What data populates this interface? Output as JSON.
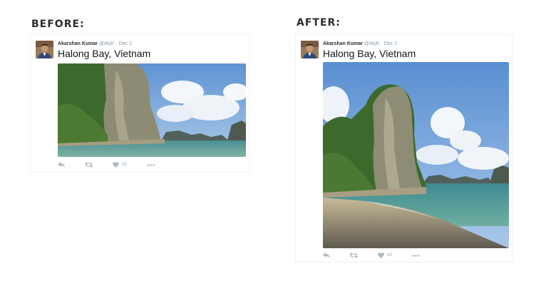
{
  "labels": {
    "before": "BEFORE:",
    "after": "AFTER:"
  },
  "tweet": {
    "author_name": "Akarshan Kumar",
    "handle": "@AkjK",
    "separator": "·",
    "date": "Dec 2",
    "text": "Halong Bay, Vietnam",
    "like_count": "10"
  },
  "colors": {
    "sky": "#6f9fd8",
    "water": "#3e8f8a",
    "rock": "#6b6a55",
    "foliage": "#3f6b2a",
    "icon_gray": "#aab8c2"
  },
  "icons": [
    "reply-icon",
    "retweet-icon",
    "heart-icon",
    "more-icon"
  ]
}
